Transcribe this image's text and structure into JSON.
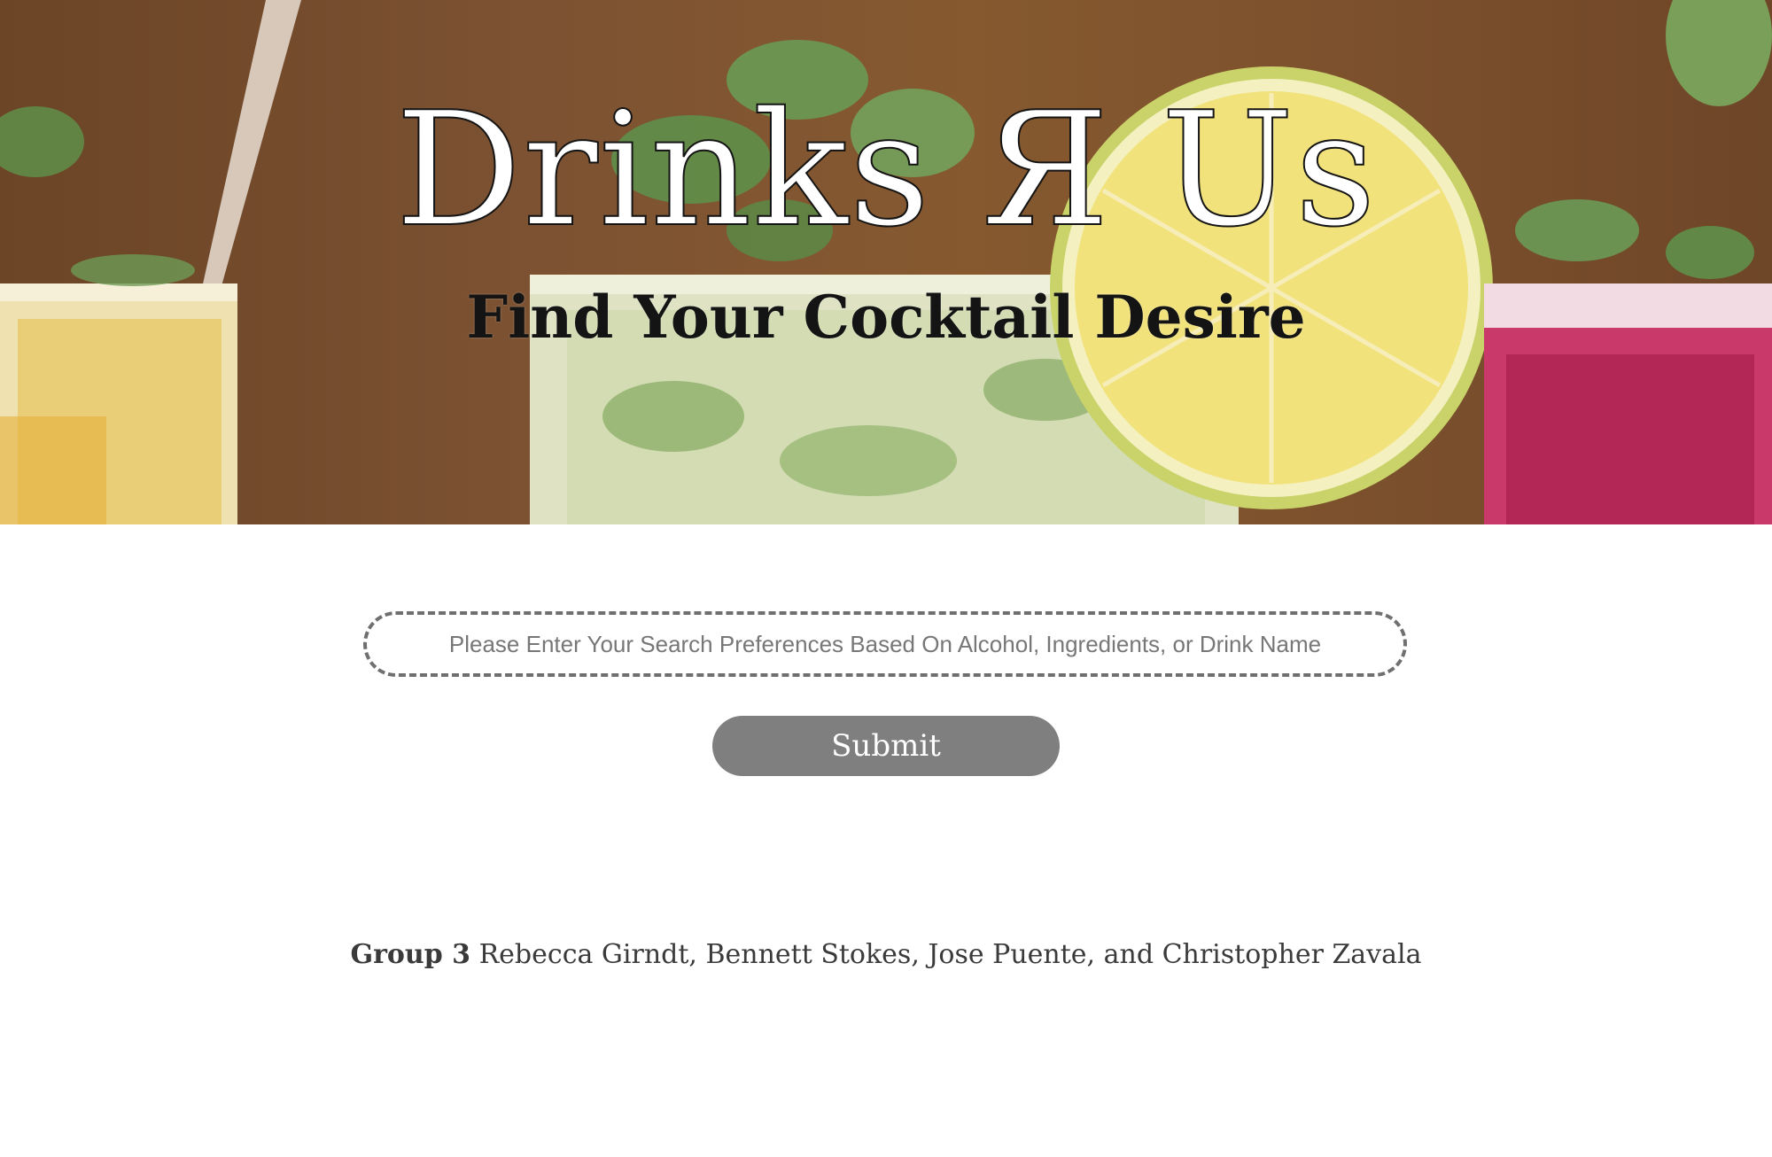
{
  "hero": {
    "title": "Drinks Я Us",
    "subtitle": "Find Your Cocktail Desire"
  },
  "search": {
    "placeholder": "Please Enter Your Search Preferences Based On Alcohol, Ingredients, or Drink Name",
    "value": ""
  },
  "submit": {
    "label": "Submit"
  },
  "footer": {
    "group": "Group 3",
    "members": "Rebecca Girndt, Bennett Stokes, Jose Puente, and Christopher Zavala"
  },
  "colors": {
    "button_bg": "#7f7f7f",
    "search_border": "#6f6f6f",
    "hero_bg": "#7c5232"
  }
}
